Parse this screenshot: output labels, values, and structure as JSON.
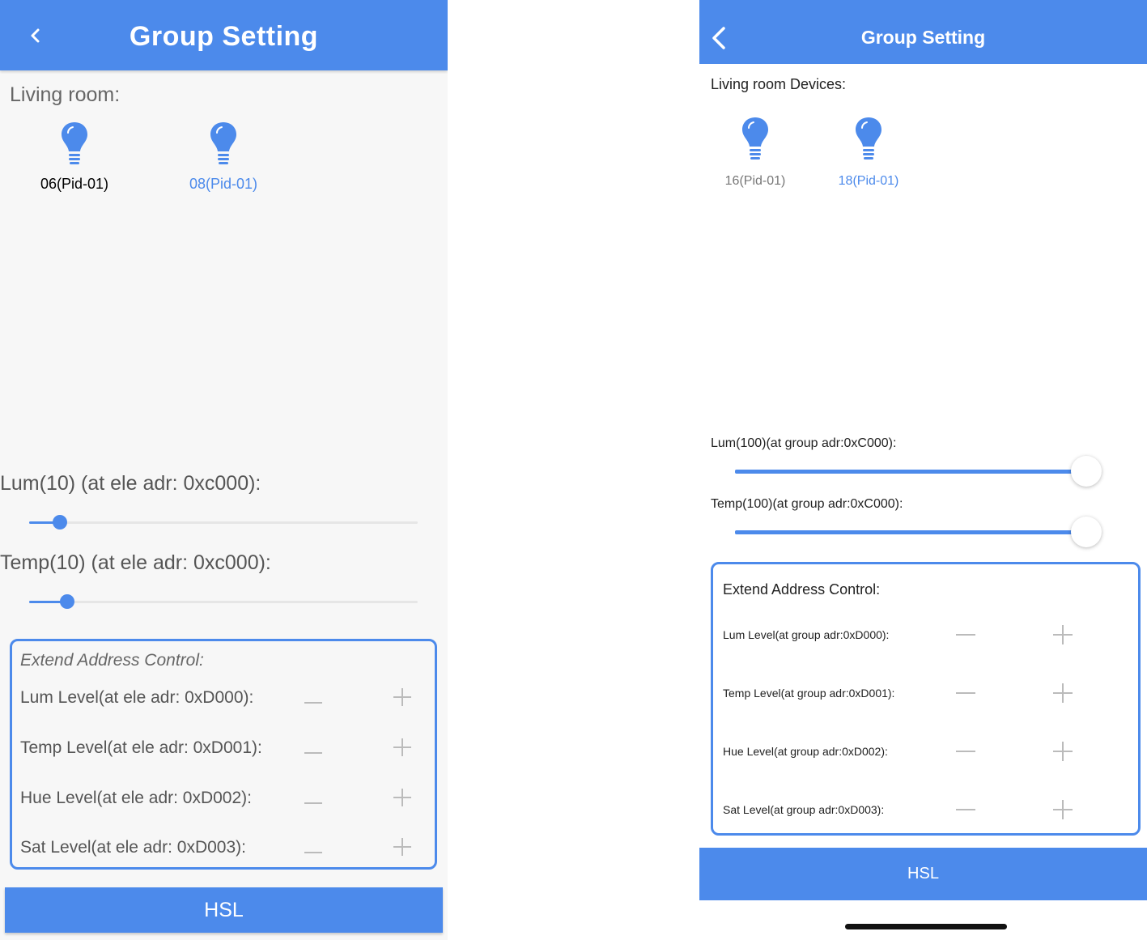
{
  "left": {
    "header": {
      "title": "Group Setting"
    },
    "room_label": "Living room:",
    "devices": [
      {
        "label": "06(Pid-01)",
        "color": "#000000"
      },
      {
        "label": "08(Pid-01)",
        "color": "#4c8aeb"
      }
    ],
    "sliders": {
      "lum": {
        "label": "Lum(10) (at ele adr: 0xc000):",
        "value_fraction": 0.08
      },
      "temp": {
        "label": "Temp(10) (at ele adr: 0xc000):",
        "value_fraction": 0.1
      }
    },
    "extend": {
      "title": "Extend Address Control:",
      "rows": [
        {
          "label": "Lum Level(at ele adr: 0xD000):"
        },
        {
          "label": "Temp Level(at ele adr: 0xD001):"
        },
        {
          "label": "Hue Level(at ele adr: 0xD002):"
        },
        {
          "label": "Sat Level(at ele adr: 0xD003):"
        }
      ]
    },
    "hsl_button": "HSL"
  },
  "right": {
    "header": {
      "title": "Group Setting"
    },
    "room_label": "Living room Devices:",
    "devices": [
      {
        "label": "16(Pid-01)",
        "color": "#777777"
      },
      {
        "label": "18(Pid-01)",
        "color": "#4c8aeb"
      }
    ],
    "sliders": {
      "lum": {
        "label": "Lum(100)(at group adr:0xC000):",
        "value_fraction": 1.0
      },
      "temp": {
        "label": "Temp(100)(at group adr:0xC000):",
        "value_fraction": 1.0
      }
    },
    "extend": {
      "title": "Extend Address Control:",
      "rows": [
        {
          "label": "Lum Level(at group adr:0xD000):"
        },
        {
          "label": "Temp Level(at group adr:0xD001):"
        },
        {
          "label": "Hue Level(at group adr:0xD002):"
        },
        {
          "label": "Sat Level(at group adr:0xD003):"
        }
      ]
    },
    "hsl_button": "HSL"
  },
  "colors": {
    "accent": "#4c8aeb",
    "control_gray": "#bbbbbb"
  },
  "icons": {
    "back": "chevron-left-icon",
    "bulb": "lightbulb-icon",
    "minus": "minus-icon",
    "plus": "plus-icon"
  }
}
